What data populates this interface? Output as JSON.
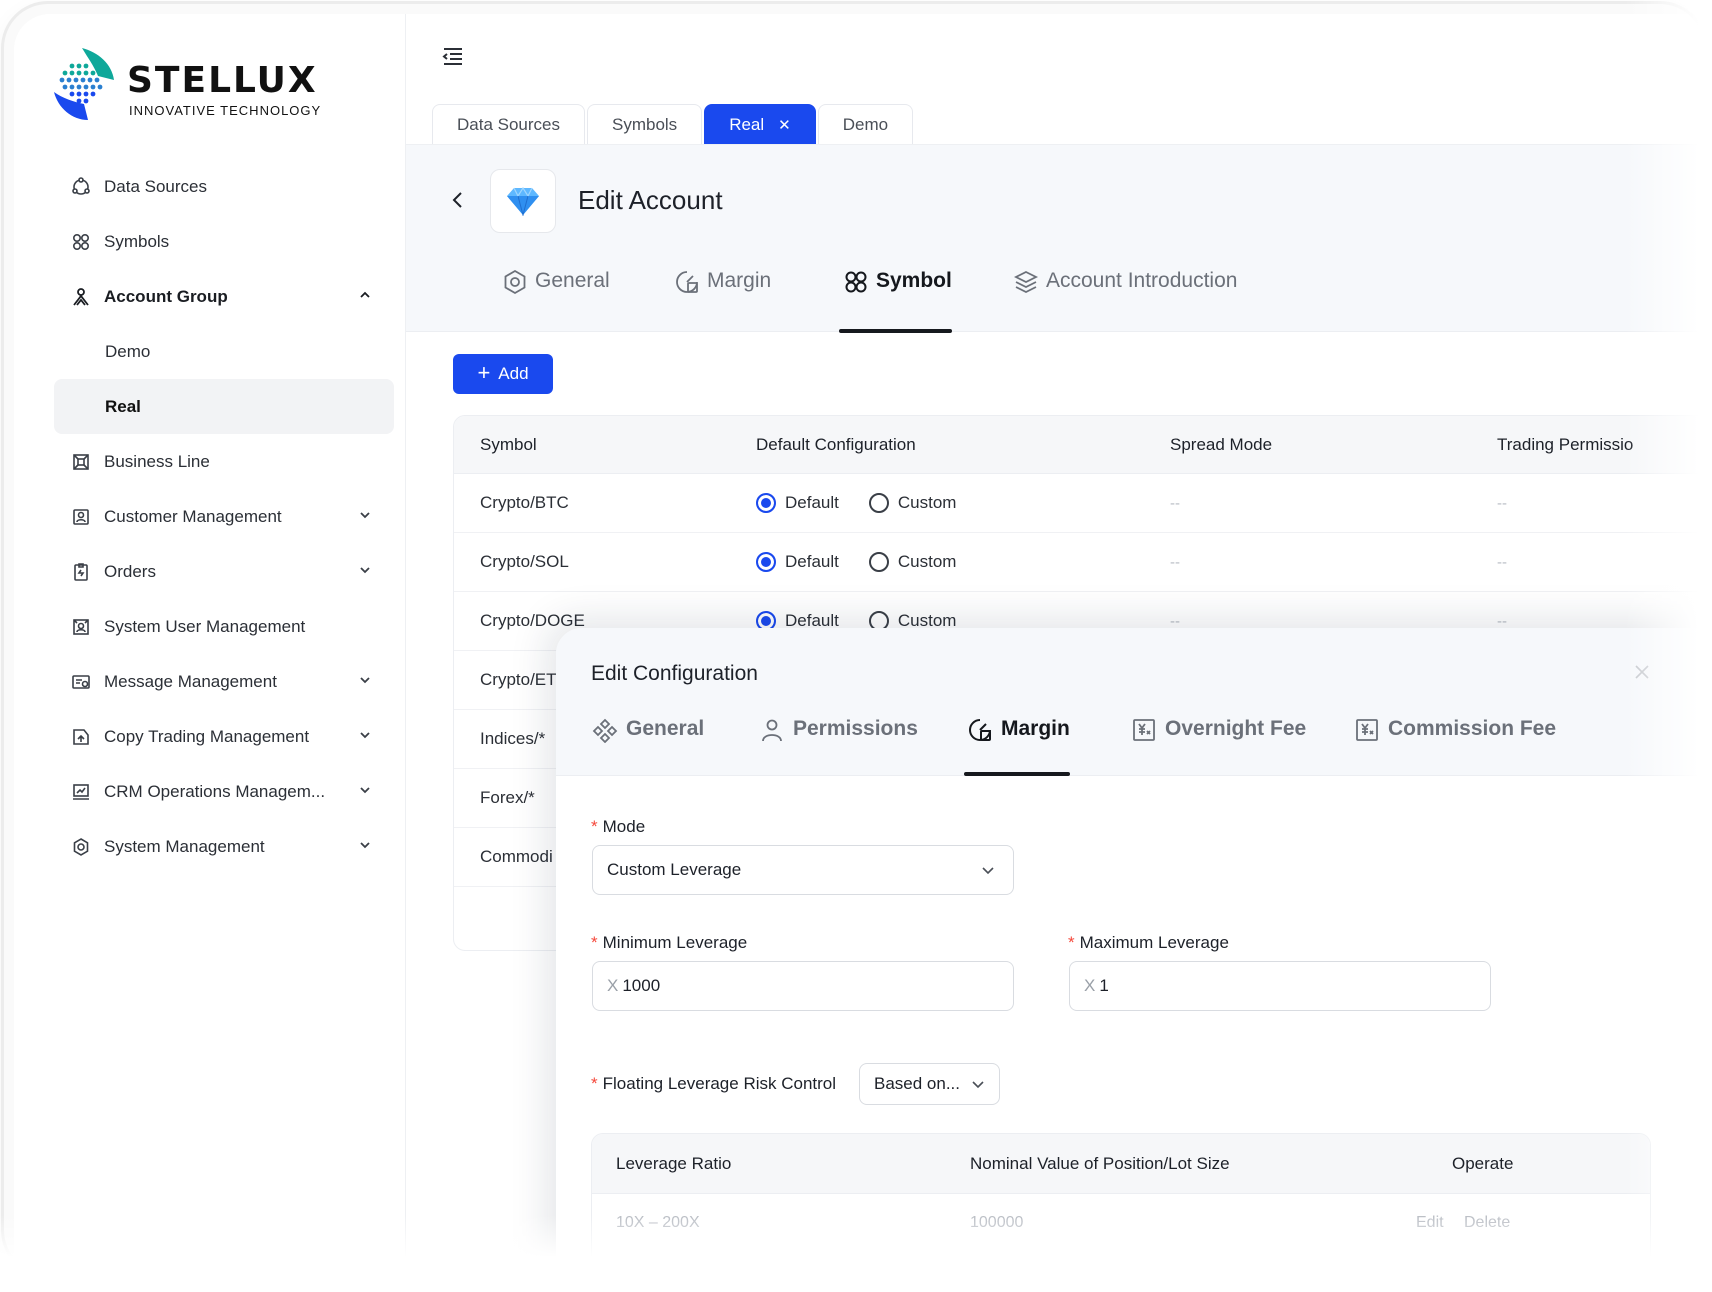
{
  "brand": {
    "name": "STELLUX",
    "tagline": "INNOVATIVE TECHNOLOGY",
    "accent": "#1a49ee",
    "logo_colors": [
      "#0fa89a",
      "#1a49ee"
    ]
  },
  "sidebar": {
    "items": [
      {
        "label": "Data Sources",
        "icon": "data-sources-icon"
      },
      {
        "label": "Symbols",
        "icon": "symbols-icon"
      },
      {
        "label": "Account Group",
        "icon": "account-group-icon",
        "expanded": true
      },
      {
        "label": "Demo"
      },
      {
        "label": "Real",
        "active": true
      },
      {
        "label": "Business Line",
        "icon": "business-line-icon"
      },
      {
        "label": "Customer Management",
        "icon": "customer-icon",
        "expandable": true
      },
      {
        "label": "Orders",
        "icon": "orders-icon",
        "expandable": true
      },
      {
        "label": "System User Management",
        "icon": "system-user-icon"
      },
      {
        "label": "Message Management",
        "icon": "message-icon",
        "expandable": true
      },
      {
        "label": "Copy Trading Management",
        "icon": "copy-trading-icon",
        "expandable": true
      },
      {
        "label": "CRM Operations Managem...",
        "icon": "crm-icon",
        "expandable": true
      },
      {
        "label": "System Management",
        "icon": "settings-icon",
        "expandable": true
      }
    ]
  },
  "page_tabs": [
    {
      "label": "Data Sources"
    },
    {
      "label": "Symbols"
    },
    {
      "label": "Real",
      "active": true
    },
    {
      "label": "Demo"
    }
  ],
  "editor": {
    "title": "Edit Account",
    "tabs": [
      "General",
      "Margin",
      "Symbol",
      "Account Introduction"
    ],
    "active_tab": "Symbol",
    "add_label": "Add"
  },
  "symbol_table": {
    "columns": [
      "Symbol",
      "Default Configuration",
      "Spread Mode",
      "Trading Permissio"
    ],
    "option_default": "Default",
    "option_custom": "Custom",
    "empty": "--",
    "rows": [
      {
        "symbol": "Crypto/BTC",
        "config": "Default"
      },
      {
        "symbol": "Crypto/SOL",
        "config": "Default"
      },
      {
        "symbol": "Crypto/DOGE",
        "config": "Default"
      },
      {
        "symbol": "Crypto/ET"
      },
      {
        "symbol": "Indices/*"
      },
      {
        "symbol": "Forex/*"
      },
      {
        "symbol": "Commodi"
      }
    ]
  },
  "config_drawer": {
    "title": "Edit Configuration",
    "tabs": [
      "General",
      "Permissions",
      "Margin",
      "Overnight Fee",
      "Commission Fee"
    ],
    "active_tab": "Margin",
    "mode_label": "Mode",
    "mode_value": "Custom Leverage",
    "min_leverage_label": "Minimum Leverage",
    "min_leverage_prefix": "X",
    "min_leverage_value": "1000",
    "max_leverage_label": "Maximum Leverage",
    "max_leverage_prefix": "X",
    "max_leverage_value": "1",
    "floating_label": "Floating Leverage Risk Control",
    "floating_value": "Based on...",
    "leverage_table": {
      "columns": [
        "Leverage Ratio",
        "Nominal Value of Position/Lot Size",
        "Operate"
      ],
      "rows": [
        {
          "ratio": "10X – 200X",
          "nominal": "100000",
          "edit": "Edit",
          "delete": "Delete"
        }
      ]
    }
  }
}
